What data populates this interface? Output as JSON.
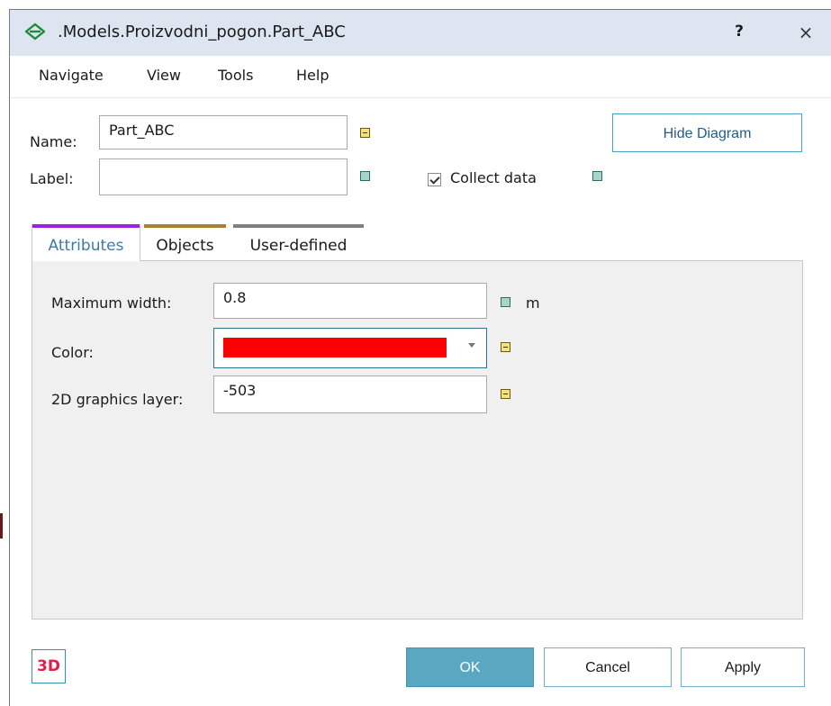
{
  "window": {
    "title": ".Models.Proizvodni_pogon.Part_ABC",
    "help_label": "?",
    "close_label": "×"
  },
  "menu": {
    "items": [
      {
        "label": "Navigate"
      },
      {
        "label": "View"
      },
      {
        "label": "Tools"
      },
      {
        "label": "Help"
      }
    ]
  },
  "form": {
    "name_label": "Name:",
    "name_value": "Part_ABC",
    "label_label": "Label:",
    "label_value": "",
    "collect_data_label": "Collect data",
    "collect_data_checked": true,
    "hide_diagram_label": "Hide Diagram"
  },
  "tabs": [
    {
      "label": "Attributes",
      "color": "#a020e0",
      "active": true
    },
    {
      "label": "Objects",
      "color": "#a8822e",
      "active": false
    },
    {
      "label": "User-defined",
      "color": "#7f7f7f",
      "active": false
    }
  ],
  "attributes": {
    "max_width_label": "Maximum width:",
    "max_width_value": "0.8",
    "max_width_unit": "m",
    "color_label": "Color:",
    "color_value": "#ff0000",
    "layer_label": "2D graphics layer:",
    "layer_value": "-503"
  },
  "footer": {
    "badge_3d": "3D",
    "ok_label": "OK",
    "cancel_label": "Cancel",
    "apply_label": "Apply"
  },
  "colors": {
    "titlebar": "#dde6f0",
    "accent": "#5aa7c2",
    "teal_marker": "#a9d4cc",
    "yellow_marker": "#f6e27a"
  }
}
